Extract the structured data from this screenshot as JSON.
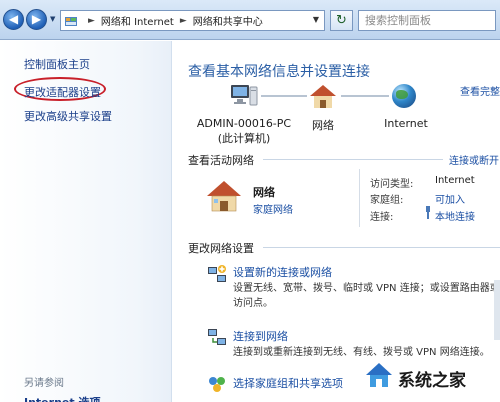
{
  "address_bar": {
    "crumbs": [
      "网络和 Internet",
      "网络和共享中心"
    ],
    "search_placeholder": "搜索控制面板"
  },
  "sidebar": {
    "home": "控制面板主页",
    "items": [
      "更改适配器设置",
      "更改高级共享设置"
    ],
    "see_also_title": "另请参阅",
    "see_also_items": [
      "Internet 选项"
    ]
  },
  "main": {
    "title": "查看基本网络信息并设置连接",
    "view_full_map": "查看完整",
    "map": {
      "computer_name": "ADMIN-00016-PC",
      "computer_sub": "(此计算机)",
      "network": "网络",
      "internet": "Internet"
    },
    "active_section": {
      "label": "查看活动网络",
      "connect_disconnect": "连接或断开",
      "network_name": "网络",
      "network_type": "家庭网络",
      "access_type_label": "访问类型:",
      "access_type_value": "Internet",
      "homegroup_label": "家庭组:",
      "homegroup_value": "可加入",
      "connections_label": "连接:",
      "connections_value": "本地连接"
    },
    "change_section": {
      "label": "更改网络设置",
      "tasks": [
        {
          "title": "设置新的连接或网络",
          "desc": "设置无线、宽带、拨号、临时或 VPN 连接；或设置路由器或访问点。"
        },
        {
          "title": "连接到网络",
          "desc": "连接到或重新连接到无线、有线、拨号或 VPN 网络连接。"
        },
        {
          "title": "选择家庭组和共享选项",
          "desc": ""
        }
      ]
    }
  },
  "watermark": {
    "text": "系统之家"
  },
  "colors": {
    "link": "#1b4fa3",
    "title": "#2a5ea5",
    "highlight_oval": "#c8202a"
  }
}
